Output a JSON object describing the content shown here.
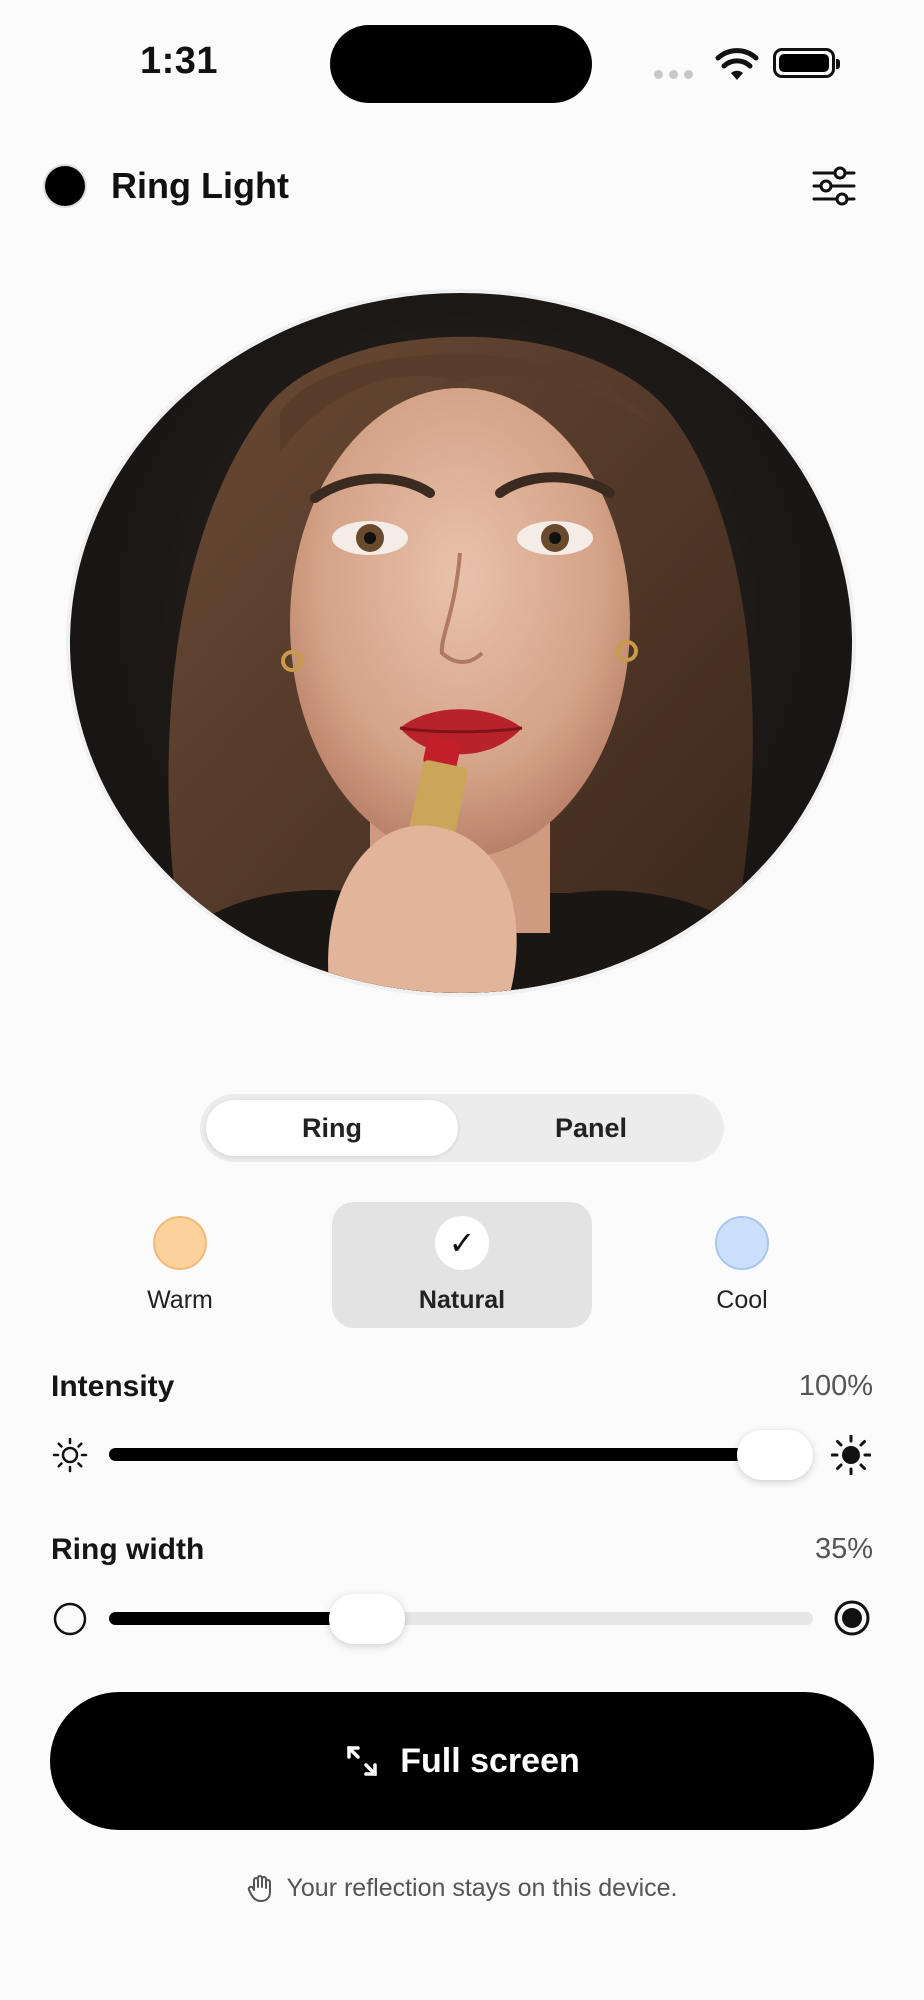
{
  "status_bar": {
    "time": "1:31"
  },
  "header": {
    "title": "Ring Light",
    "settings_icon": "sliders-icon"
  },
  "mode": {
    "options": [
      "Ring",
      "Panel"
    ],
    "selected": "Ring"
  },
  "tones": [
    {
      "label": "Warm",
      "color": "#fdd19b",
      "selected": false
    },
    {
      "label": "Natural",
      "color": "#ffffff",
      "selected": true
    },
    {
      "label": "Cool",
      "color": "#cde0fb",
      "selected": false
    }
  ],
  "intensity": {
    "label": "Intensity",
    "value_text": "100%",
    "value": 1.0
  },
  "ring_width": {
    "label": "Ring width",
    "value_text": "35%",
    "value": 0.35
  },
  "fullscreen": {
    "label": "Full screen"
  },
  "privacy": {
    "text": "Your reflection stays on this device."
  },
  "colors": {
    "accent": "#000000",
    "background": "#fbfbfb",
    "track": "#e6e6e6"
  }
}
